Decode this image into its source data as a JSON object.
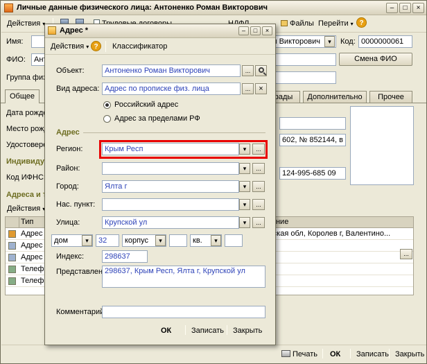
{
  "colors": {
    "title_grad_a": "#f7f3e7",
    "title_grad_b": "#d8d2bc",
    "value_text": "#2e43b8",
    "section_text": "#6d6d21",
    "highlight": "#e80000"
  },
  "icons": {
    "minimize": "–",
    "maximize": "□",
    "close": "×",
    "dropdown": "▾",
    "more": "...",
    "clear": "×",
    "help": "?"
  },
  "main": {
    "title": "Личные данные физического лица: Антоненко Роман Викторович",
    "toolbar": {
      "actions": "Действия",
      "labor": "Трудовые договоры",
      "ndfl": "НДФЛ",
      "files": "Файлы",
      "goto": "Перейти"
    },
    "form": {
      "name_label": "Имя:",
      "name_value": "Антоненко Роман Викторович",
      "code_label": "Код:",
      "code_value": "0000000061",
      "fio_label": "ФИО:",
      "fio_value": "Антоненко Роман Викторович",
      "change_fio": "Смена ФИО",
      "group_label": "Группа физ. лиц:"
    },
    "tabs": [
      {
        "label": "Общее"
      },
      {
        "label": "Награды"
      },
      {
        "label": "Дополнительно"
      },
      {
        "label": "Прочее"
      }
    ],
    "left": {
      "birth_date": "Дата рождения:",
      "birth_place": "Место рождения:",
      "id_doc": "Удостоверение:",
      "individual_numbers": "Индивидуальные номера",
      "ifns": "Код ИФНС:",
      "addresses_header": "Адреса и телефоны",
      "actions": "Действия"
    },
    "right": {
      "doc_value": "602, № 852144, в ...",
      "pfr_value": "124-995-685 09"
    },
    "table": {
      "headers": [
        "Тип",
        "Представление"
      ],
      "rows": [
        {
          "type": "Адрес по прописке физ. лица",
          "repr": "Московская обл, Королев г, Валентино..."
        },
        {
          "type": "Адрес проживания физ. лица",
          "repr": ""
        },
        {
          "type": "Адрес для информирования",
          "repr": ""
        },
        {
          "type": "Телефон домашний физ. лица",
          "repr": ""
        },
        {
          "type": "Телефон рабочий физ. лица",
          "repr": ""
        }
      ]
    },
    "bottom": {
      "print": "Печать",
      "ok": "ОК",
      "save": "Записать",
      "close": "Закрыть"
    }
  },
  "dialog": {
    "title": "Адрес *",
    "toolbar": {
      "actions": "Действия",
      "classifier": "Классификатор"
    },
    "object_label": "Объект:",
    "object_value": "Антоненко Роман Викторович",
    "kind_label": "Вид адреса:",
    "kind_value": "Адрес по прописке физ. лица",
    "radio_ru": "Российский адрес",
    "radio_foreign": "Адрес за пределами РФ",
    "group": "Адрес",
    "region_label": "Регион:",
    "region_value": "Крым Респ",
    "district_label": "Район:",
    "district_value": "",
    "city_label": "Город:",
    "city_value": "Ялта г",
    "settlement_label": "Нас. пункт:",
    "settlement_value": "",
    "street_label": "Улица:",
    "street_value": "Крупской ул",
    "house_label": "дом",
    "house_value": "32",
    "building_label": "корпус",
    "building_value": "",
    "flat_label": "кв.",
    "flat_value": "",
    "zip_label": "Индекс:",
    "zip_value": "298637",
    "presentation_label": "Представление:",
    "presentation_value": "298637, Крым Респ, Ялта г, Крупской ул",
    "comment_label": "Комментарий:",
    "comment_value": "",
    "buttons": {
      "ok": "ОК",
      "save": "Записать",
      "close": "Закрыть"
    }
  }
}
